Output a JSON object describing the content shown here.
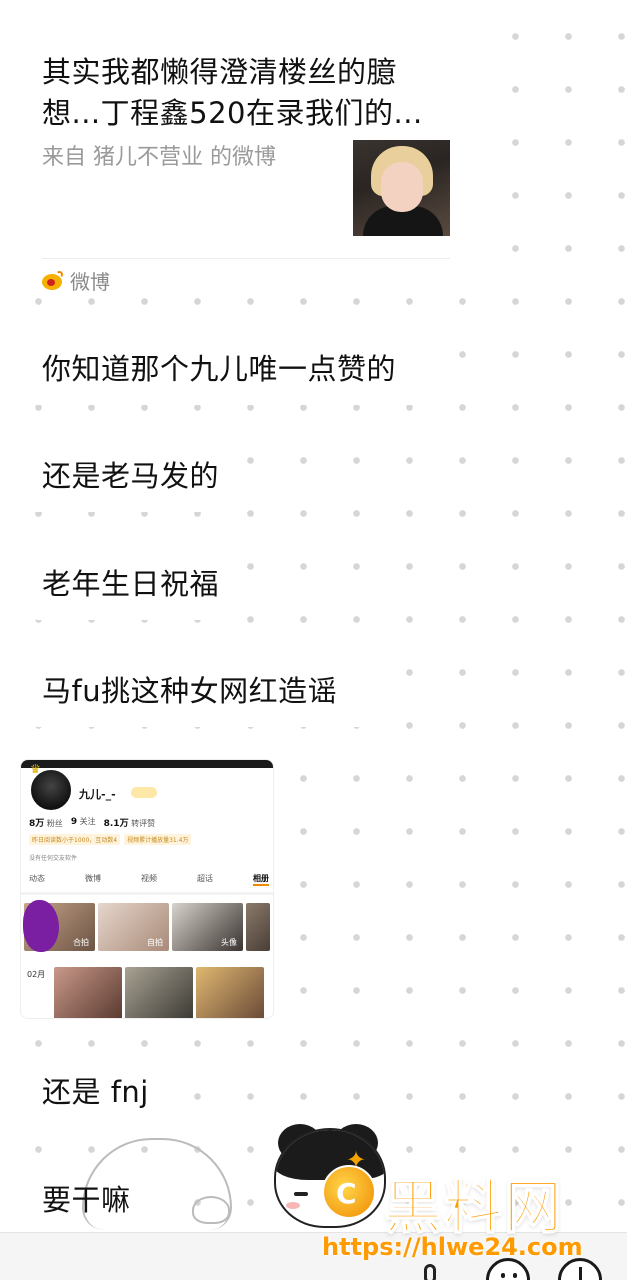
{
  "shared_card": {
    "title_line1": "其实我都懒得澄清楼丝的臆",
    "title_line2": "想...丁程鑫520在录我们的...",
    "source": "来自 猪儿不营业 的微博",
    "brand": "微博"
  },
  "messages": [
    "你知道那个九儿唯一点赞的",
    "还是老马发的",
    "老年生日祝福",
    "马fu挑这种女网红造谣",
    "还是 fnj",
    "要干嘛"
  ],
  "screenshot": {
    "username": "九儿-_-",
    "followers_value": "8万",
    "followers_label": "粉丝",
    "following_value": "9",
    "following_label": "关注",
    "reposts_value": "8.1万",
    "reposts_label": "转评赞",
    "tag1": "昨日阅读数小于1000，互动数4",
    "tag2": "视频累计播放量31.4万",
    "note": "没有任何交友软件",
    "tabs": [
      "动态",
      "微博",
      "视频",
      "超话",
      "相册"
    ],
    "tile_labels": [
      "合拍",
      "自拍",
      "头像"
    ],
    "month": "02月"
  },
  "watermark": {
    "brand": "黑料网",
    "url": "https://hlwe24.com"
  },
  "colors": {
    "watermark_orange": "#ff9a00",
    "background": "#ffffff",
    "dot": "#d6d6d6"
  },
  "icons": [
    "weibo-logo-icon",
    "voice-icon",
    "emoji-icon",
    "add-icon"
  ]
}
